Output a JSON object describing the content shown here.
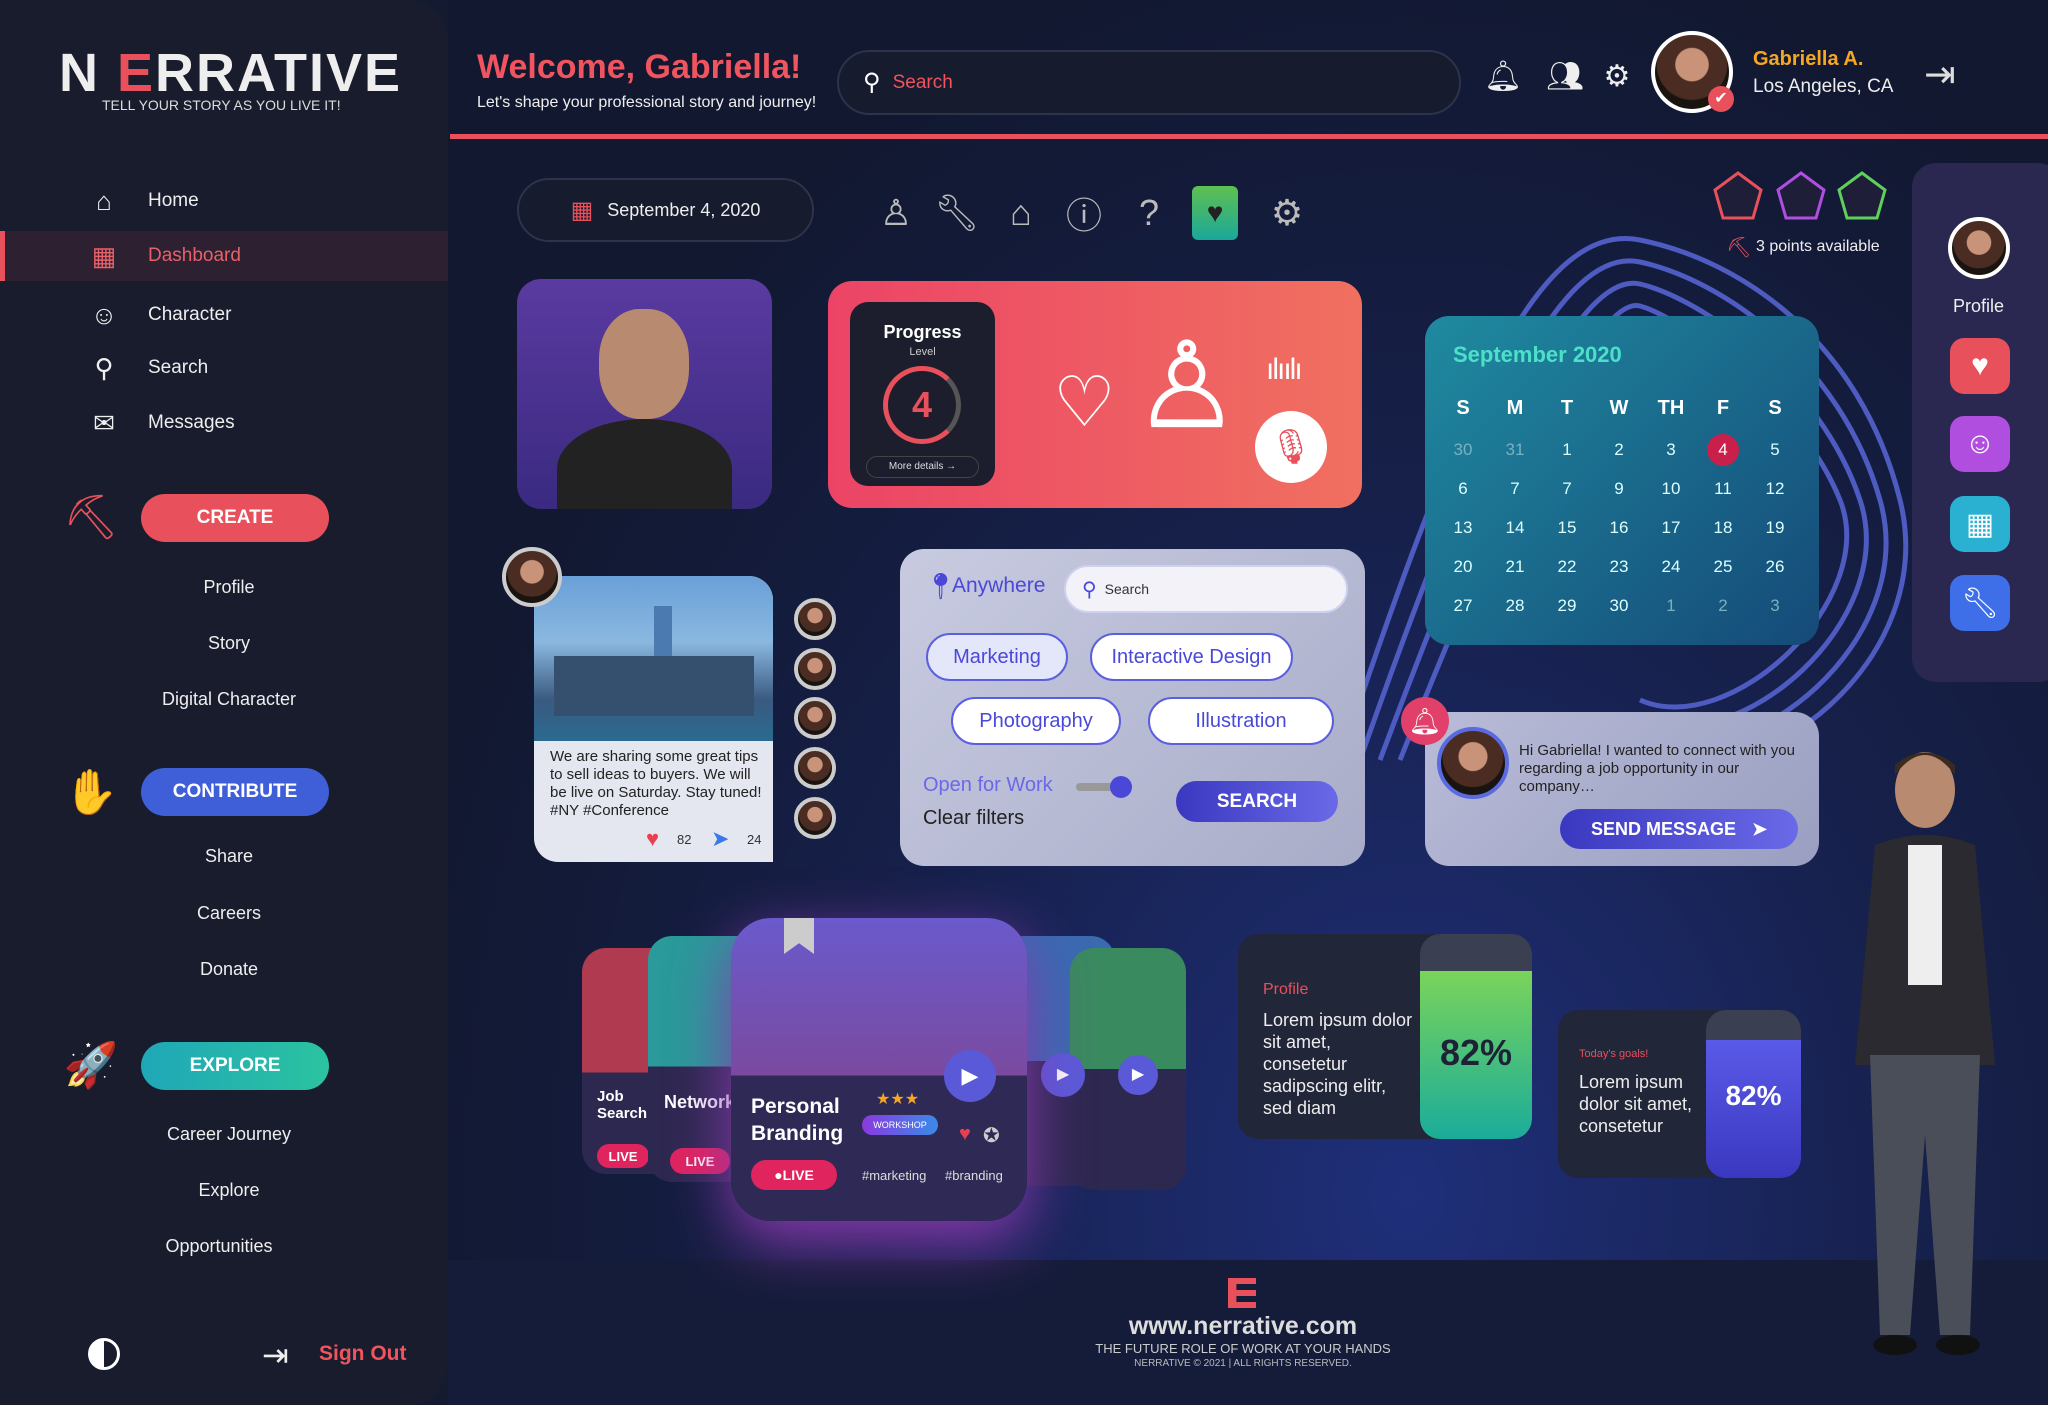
{
  "brand": {
    "name_n": "N",
    "name_e": "E",
    "name_rest": "RRATIVE",
    "tagline": "TELL YOUR STORY AS YOU LIVE IT!"
  },
  "sidebar": {
    "nav": [
      {
        "label": "Home",
        "icon": "home-icon"
      },
      {
        "label": "Dashboard",
        "icon": "dashboard-icon",
        "active": true
      },
      {
        "label": "Character",
        "icon": "character-icon"
      },
      {
        "label": "Search",
        "icon": "search-icon"
      },
      {
        "label": "Messages",
        "icon": "mail-icon"
      }
    ],
    "sections": [
      {
        "button": "CREATE",
        "icon": "shovel-icon",
        "color": "#e8505b",
        "items": [
          "Profile",
          "Story",
          "Digital Character"
        ]
      },
      {
        "button": "CONTRIBUTE",
        "icon": "hand-icon",
        "color": "#3f5fd8",
        "items": [
          "Share",
          "Careers",
          "Donate"
        ]
      },
      {
        "button": "EXPLORE",
        "icon": "rocket-icon",
        "color": "#1fb3ad",
        "items": [
          "Career Journey",
          "Explore",
          "Opportunities"
        ]
      }
    ],
    "sign_out": "Sign Out"
  },
  "header": {
    "welcome": "Welcome, Gabriella!",
    "subtitle": "Let's shape your professional story and journey!",
    "search_placeholder": "Search",
    "user_name": "Gabriella A.",
    "user_location": "Los Angeles, CA"
  },
  "toolbar": {
    "date": "September 4, 2020",
    "tools": [
      "body-icon",
      "wrench-icon",
      "garage-icon",
      "info-scroll-icon",
      "question-scroll-icon",
      "heart-book-icon",
      "gear-icon"
    ]
  },
  "badges": {
    "points": "3 points available",
    "colors": [
      "#e8505b",
      "#b04ee0",
      "#5fd05a"
    ]
  },
  "progress": {
    "title": "Progress",
    "subtitle": "Level",
    "level": "4",
    "more": "More details →"
  },
  "calendar": {
    "title": "September 2020",
    "days": [
      "S",
      "M",
      "T",
      "W",
      "TH",
      "F",
      "S"
    ],
    "weeks": [
      [
        "30",
        "31",
        "1",
        "2",
        "3",
        "4",
        "5"
      ],
      [
        "6",
        "7",
        "7",
        "9",
        "10",
        "11",
        "12"
      ],
      [
        "13",
        "14",
        "15",
        "16",
        "17",
        "18",
        "19"
      ],
      [
        "20",
        "21",
        "22",
        "23",
        "24",
        "25",
        "26"
      ],
      [
        "27",
        "28",
        "29",
        "30",
        "1",
        "2",
        "3"
      ]
    ],
    "selected": "4"
  },
  "post": {
    "text": "We are sharing some great tips to sell ideas to buyers. We will be live on Saturday. Stay tuned! #NY #Conference",
    "likes": "82",
    "shares": "24"
  },
  "filters": {
    "location": "Anywhere",
    "search_placeholder": "Search",
    "chips": [
      "Marketing",
      "Interactive Design",
      "Photography",
      "Illustration"
    ],
    "open_for_work": "Open for Work",
    "open_for_work_on": true,
    "clear": "Clear filters",
    "search_button": "SEARCH"
  },
  "message": {
    "text": "Hi Gabriella! I wanted to connect with you regarding a job opportunity in our company…",
    "button": "SEND MESSAGE"
  },
  "right_panel": {
    "profile_label": "Profile",
    "buttons": [
      "heart-icon",
      "contact-icon",
      "calendar-icon",
      "wrench-icon"
    ]
  },
  "carousel": {
    "cards": [
      {
        "title": "Job Search",
        "live": "LIVE"
      },
      {
        "title": "Networking",
        "live": "LIVE"
      },
      {
        "title": "Personal Branding",
        "live": "LIVE",
        "badge": "WORKSHOP",
        "tags": [
          "#marketing",
          "#branding"
        ],
        "stars": "★★★"
      }
    ]
  },
  "stats": [
    {
      "label": "Profile",
      "text": "Lorem ipsum dolor sit amet, consetetur sadipscing elitr, sed diam",
      "value": "82%",
      "percent": 82
    },
    {
      "label": "Today's goals!",
      "text": "Lorem ipsum dolor sit amet, consetetur",
      "value": "82%",
      "percent": 82
    }
  ],
  "footer": {
    "url": "www.nerrative.com",
    "tagline": "THE FUTURE ROLE OF WORK AT YOUR HANDS",
    "copyright": "NERRATIVE © 2021  | ALL RIGHTS RESERVED."
  }
}
